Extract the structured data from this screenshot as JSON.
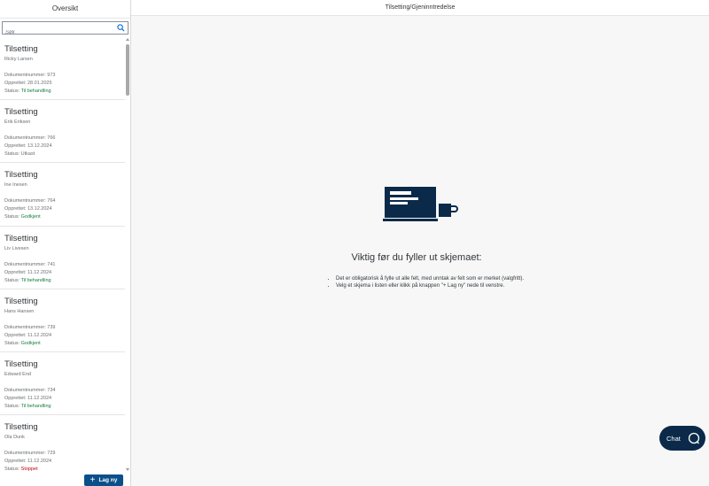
{
  "sidebar": {
    "title": "Oversikt",
    "search_placeholder": "Søk",
    "new_button_label": "Lag ny",
    "items": [
      {
        "title": "Tilsetting",
        "name": "Ricky Larsen",
        "doc": "Dokumentnummer: 973",
        "created": "Opprettet: 28.01.2025",
        "status_label": "Status: ",
        "status": "Til behandling",
        "status_color": "green"
      },
      {
        "title": "Tilsetting",
        "name": "Erik Eriksen",
        "doc": "Dokumentnummer: 766",
        "created": "Opprettet: 13.12.2024",
        "status_label": "Status: ",
        "status": "Utkast",
        "status_color": "plain"
      },
      {
        "title": "Tilsetting",
        "name": "Ine Inesen",
        "doc": "Dokumentnummer: 764",
        "created": "Opprettet: 13.12.2024",
        "status_label": "Status: ",
        "status": "Godkjent",
        "status_color": "green"
      },
      {
        "title": "Tilsetting",
        "name": "Liv Livesen",
        "doc": "Dokumentnummer: 741",
        "created": "Opprettet: 11.12.2024",
        "status_label": "Status: ",
        "status": "Til behandling",
        "status_color": "green"
      },
      {
        "title": "Tilsetting",
        "name": "Hans Hansen",
        "doc": "Dokumentnummer: 739",
        "created": "Opprettet: 11.12.2024",
        "status_label": "Status: ",
        "status": "Godkjent",
        "status_color": "green"
      },
      {
        "title": "Tilsetting",
        "name": "Edward End",
        "doc": "Dokumentnummer: 734",
        "created": "Opprettet: 11.12.2024",
        "status_label": "Status: ",
        "status": "Til behandling",
        "status_color": "green"
      },
      {
        "title": "Tilsetting",
        "name": "Ola Dunk",
        "doc": "Dokumentnummer: 729",
        "created": "Opprettet: 11.12.2024",
        "status_label": "Status: ",
        "status": "Stoppet",
        "status_color": "red"
      }
    ]
  },
  "main": {
    "title": "Tilsetting/Gjeninntredelse",
    "message_title": "Viktig før du fyller ut skjemaet:",
    "bullets": [
      "Det er obligatorisk å fylle ut alle felt, med unntak av felt som er merket (valgfritt).",
      "Velg et skjema i listen eller klikk på knappen \"+ Lag ny\" nede til venstre."
    ]
  },
  "chat": {
    "label": "Chat"
  },
  "colors": {
    "accent": "#0b4f8a",
    "status_green": "#107e3e",
    "status_red": "#bb0000",
    "illustration": "#0b2a4a"
  },
  "icons": {
    "search": "search-icon",
    "add": "plus-icon",
    "chat": "chat-bubble-icon",
    "illustration": "laptop-coffee-illustration"
  }
}
